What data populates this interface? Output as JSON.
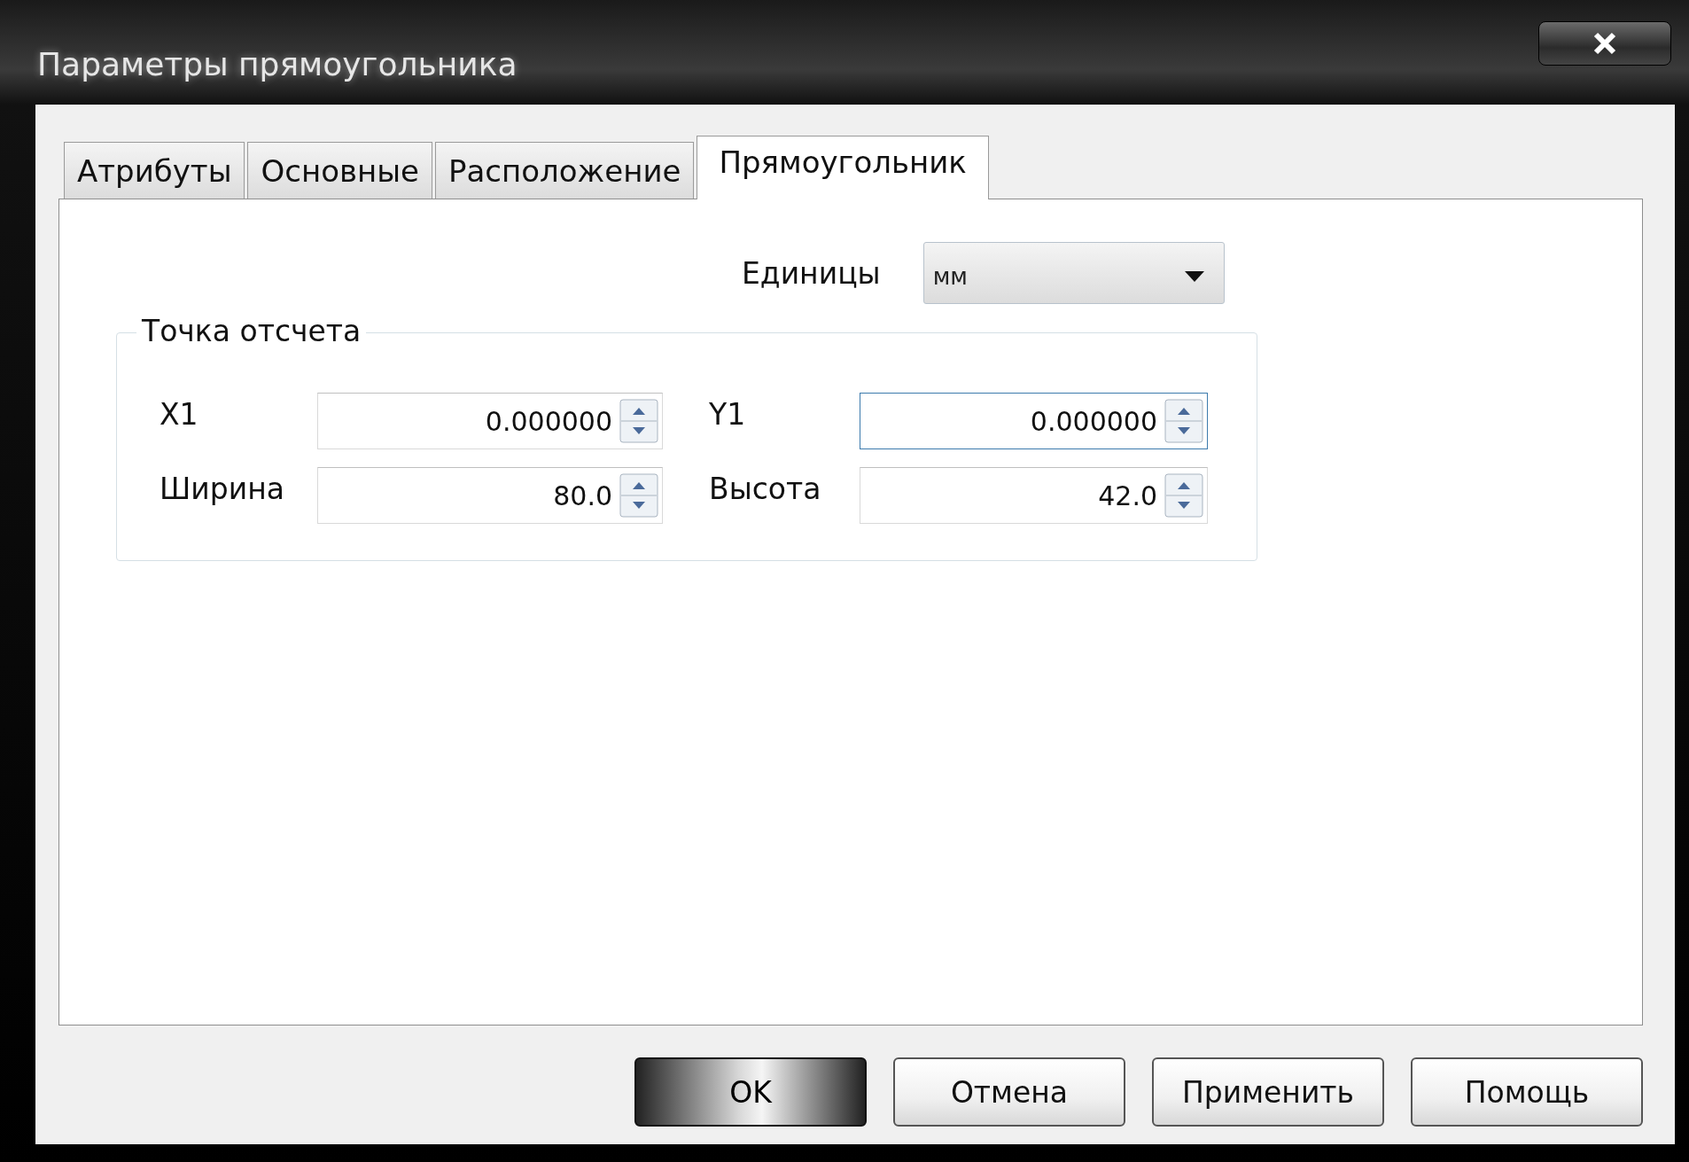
{
  "window": {
    "title": "Параметры прямоугольника"
  },
  "tabs": [
    {
      "label": "Атрибуты",
      "selected": false
    },
    {
      "label": "Основные",
      "selected": false
    },
    {
      "label": "Расположение",
      "selected": false
    },
    {
      "label": "Прямоугольник",
      "selected": true
    }
  ],
  "units": {
    "label": "Единицы",
    "value": "мм"
  },
  "group": {
    "title": "Точка отсчета",
    "fields": [
      {
        "label": "X1",
        "value": "0.000000",
        "focused": false
      },
      {
        "label": "Y1",
        "value": "0.000000",
        "focused": true
      },
      {
        "label": "Ширина",
        "value": "80.0",
        "focused": false
      },
      {
        "label": "Высота",
        "value": "42.0",
        "focused": false
      }
    ]
  },
  "buttons": [
    {
      "label": "OK",
      "default": true
    },
    {
      "label": "Отмена",
      "default": false
    },
    {
      "label": "Применить",
      "default": false
    },
    {
      "label": "Помощь",
      "default": false
    }
  ]
}
